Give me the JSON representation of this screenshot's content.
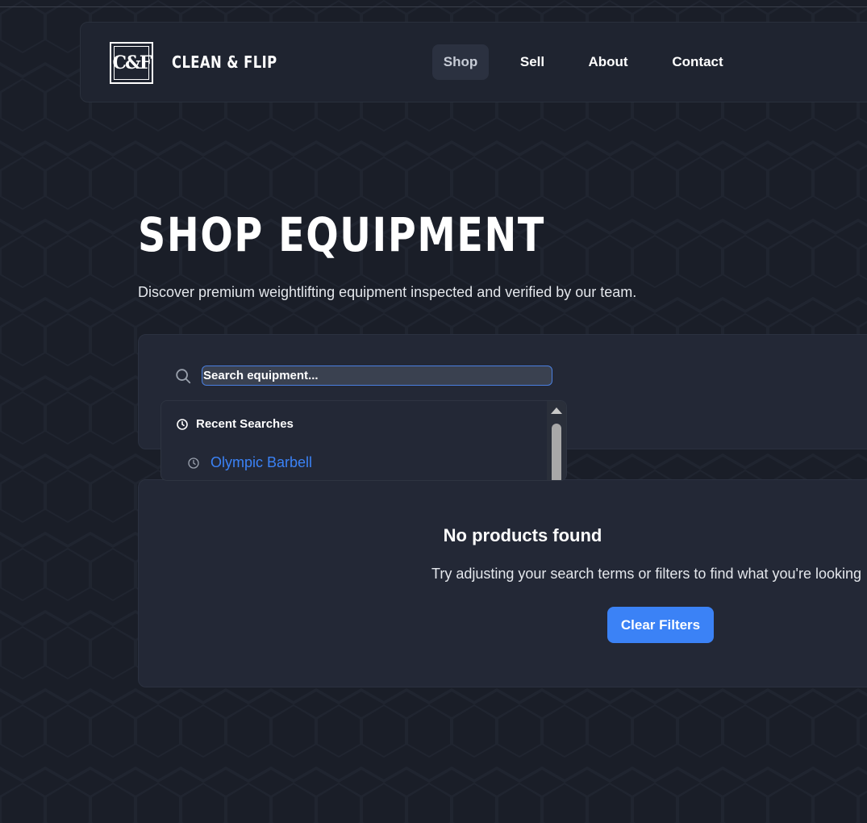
{
  "brand": {
    "logo_text": "C&F",
    "name": "CLEAN & FLIP"
  },
  "nav": {
    "items": [
      {
        "label": "Shop",
        "active": true
      },
      {
        "label": "Sell"
      },
      {
        "label": "About"
      },
      {
        "label": "Contact"
      }
    ]
  },
  "hero": {
    "title": "SHOP EQUIPMENT",
    "subtitle": "Discover premium weightlifting equipment inspected and verified by our team."
  },
  "search": {
    "placeholder": "Search equipment...",
    "icon": "search-icon",
    "dropdown": {
      "header": "Recent Searches",
      "header_icon": "clock-icon",
      "items": [
        {
          "label": "Olympic Barbell",
          "icon": "clock-icon"
        }
      ]
    }
  },
  "results": {
    "empty_title": "No products found",
    "empty_text": "Try adjusting your search terms or filters to find what you're looking",
    "clear_label": "Clear Filters"
  },
  "colors": {
    "accent": "#3b82f6",
    "background": "#1a1e28",
    "panel": "#232836"
  }
}
